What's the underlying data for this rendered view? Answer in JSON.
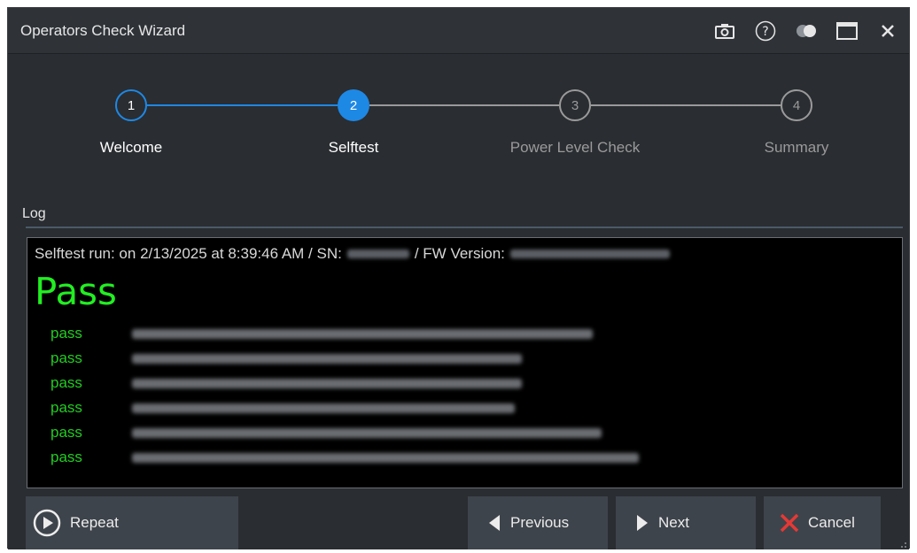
{
  "window": {
    "title": "Operators Check Wizard",
    "titlebar_icons": [
      "camera-icon",
      "help-icon",
      "toggle-icon",
      "maximize-icon",
      "close-icon"
    ]
  },
  "stepper": {
    "steps": [
      {
        "number": "1",
        "label": "Welcome",
        "state": "completed"
      },
      {
        "number": "2",
        "label": "Selftest",
        "state": "active"
      },
      {
        "number": "3",
        "label": "Power Level Check",
        "state": "pending"
      },
      {
        "number": "4",
        "label": "Summary",
        "state": "pending"
      }
    ],
    "colors": {
      "active": "#1e88e5",
      "completed_line": "#1e88e5",
      "pending": "#9a9a9a"
    }
  },
  "log": {
    "section_title": "Log",
    "header_prefix": "Selftest run: on 2/13/2025 at 8:39:46 AM / SN:",
    "header_mid": "/ FW Version:",
    "result": "Pass",
    "tests": [
      {
        "status": "pass",
        "blurred": true
      },
      {
        "status": "pass",
        "blurred": true
      },
      {
        "status": "pass",
        "blurred": true
      },
      {
        "status": "pass",
        "blurred": true
      },
      {
        "status": "pass",
        "blurred": true
      },
      {
        "status": "pass",
        "blurred": true
      }
    ],
    "colors": {
      "pass": "#22cc22",
      "result": "#22ee22"
    }
  },
  "footer": {
    "repeat_label": "Repeat",
    "previous_label": "Previous",
    "next_label": "Next",
    "cancel_label": "Cancel",
    "cancel_icon_color": "#e53935"
  }
}
